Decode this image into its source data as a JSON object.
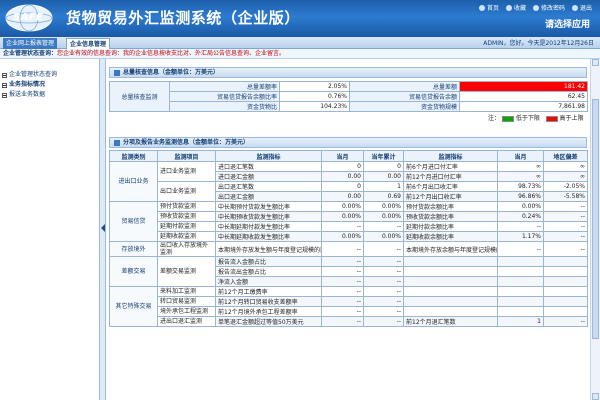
{
  "header": {
    "logo_text": "SAFE",
    "title": "货物贸易外汇监测系统（企业版）",
    "top_links": [
      "首页",
      "收藏",
      "修改密码",
      "退出"
    ],
    "welcome": "请选择应用"
  },
  "nav": {
    "tabs": [
      {
        "label": "企业网上报表管理",
        "active": false
      },
      {
        "label": "企业信息管理",
        "active": true
      }
    ],
    "user_info": "ADMIN，您好。今天是2012年12月26日"
  },
  "notice": {
    "label": "企业管理状态查询：",
    "text": "您企业有效的信息查询：我的企业信息按收支比对、外汇局公告信息查询、企业留言。"
  },
  "sidebar": {
    "items": [
      {
        "label": "企业管理状态查询",
        "bold": false
      },
      {
        "label": "业务指标情况",
        "bold": true
      },
      {
        "label": "报送业务数据",
        "bold": false
      }
    ]
  },
  "summary": {
    "title": "总量核查信息（金额单位：万美元）",
    "group_label": "总量核查监测",
    "rows": [
      {
        "l1": "总量差额率",
        "v1": "2.05%",
        "l2": "总量差额",
        "v2": "181.42",
        "v2_red": true
      },
      {
        "l1": "贸易信贷报告余额比率",
        "v1": "0.76%",
        "l2": "贸易信贷报告余额",
        "v2": "62.45",
        "v2_red": false
      },
      {
        "l1": "资金货物比",
        "v1": "104.23%",
        "l2": "资金货物规模",
        "v2": "7,861.98",
        "v2_red": false
      }
    ],
    "legend_label": "注：",
    "legend": [
      {
        "label": "低于下限",
        "color": "#00aa00"
      },
      {
        "label": "高于上限",
        "color": "#ff0000"
      }
    ]
  },
  "detail": {
    "title": "分项及报告业务监测信息（金额单位：万美元）",
    "columns": [
      "监测类别",
      "监测项目",
      "监测指标",
      "当月",
      "当年累计",
      "监测指标",
      "当月",
      "地区偏差"
    ],
    "rows": [
      {
        "cat": "进出口业务",
        "item": "进口业务监测",
        "ind1": "进口退汇笔数",
        "m1": "0",
        "y1": "0",
        "ind2": "前6个月进口付汇率",
        "m2": "∞",
        "d2": "∞"
      },
      {
        "cat": "",
        "item": "",
        "ind1": "进口退汇金额",
        "m1": "0.00",
        "y1": "0.00",
        "ind2": "前12个月进口付汇率",
        "m2": "∞",
        "d2": "∞"
      },
      {
        "cat": "",
        "item": "出口业务监测",
        "ind1": "出口退汇笔数",
        "m1": "0",
        "y1": "1",
        "ind2": "前6个月出口收汇率",
        "m2": "98.73%",
        "d2": "-2.05%"
      },
      {
        "cat": "",
        "item": "",
        "ind1": "出口退汇金额",
        "m1": "0.00",
        "y1": "0.69",
        "ind2": "前12个月出口收汇率",
        "m2": "96.86%",
        "d2": "-5.58%"
      },
      {
        "cat": "贸易信贷",
        "item": "预付货款监测",
        "ind1": "中长期预付货款发生额比率",
        "m1": "0.00%",
        "y1": "0.00%",
        "ind2": "预付货款余额比率",
        "m2": "0.00%",
        "d2": "--"
      },
      {
        "cat": "",
        "item": "预收货款监测",
        "ind1": "中长期预收货款发生额比率",
        "m1": "0.00%",
        "y1": "0.00%",
        "ind2": "预收货款余额比率",
        "m2": "0.24%",
        "d2": "--"
      },
      {
        "cat": "",
        "item": "延期付款监测",
        "ind1": "中长期延期付款发生额比率",
        "m1": "--",
        "y1": "--",
        "ind2": "延期付款余额比率",
        "m2": "--",
        "d2": "--"
      },
      {
        "cat": "",
        "item": "延期收款监测",
        "ind1": "中长期延期收款发生额比率",
        "m1": "0.00%",
        "y1": "0.00%",
        "ind2": "延期收款余额比率",
        "m2": "1.17%",
        "d2": "--"
      },
      {
        "cat": "存放境外",
        "item": "出口收入存放境外监测",
        "ind1": "本期境外存放发生额与年度登记规模的比率",
        "m1": "--",
        "y1": "--",
        "ind2": "本期境外存放余额与年度登记规模的比率",
        "m2": "--",
        "d2": "--"
      },
      {
        "cat": "差额交易",
        "item": "差额交易监测",
        "ind1": "报告流入金额占比",
        "m1": "--",
        "y1": "--",
        "ind2": "",
        "m2": "",
        "d2": ""
      },
      {
        "cat": "",
        "item": "",
        "ind1": "报告流出金额占比",
        "m1": "--",
        "y1": "--",
        "ind2": "",
        "m2": "",
        "d2": ""
      },
      {
        "cat": "",
        "item": "",
        "ind1": "净流入金额",
        "m1": "--",
        "y1": "--",
        "ind2": "",
        "m2": "",
        "d2": ""
      },
      {
        "cat": "其它特殊交易",
        "item": "来料加工监测",
        "ind1": "前12个月工缴费率",
        "m1": "--",
        "y1": "--",
        "ind2": "",
        "m2": "",
        "d2": ""
      },
      {
        "cat": "",
        "item": "转口贸易监测",
        "ind1": "前12个月转口贸易收支差额率",
        "m1": "--",
        "y1": "--",
        "ind2": "",
        "m2": "",
        "d2": ""
      },
      {
        "cat": "",
        "item": "境外承包工程监测",
        "ind1": "前12个月境外承包工程差额率",
        "m1": "--",
        "y1": "--",
        "ind2": "",
        "m2": "",
        "d2": ""
      },
      {
        "cat": "",
        "item": "进出口退汇监测",
        "ind1": "单笔退汇金额超过等值50万美元",
        "m1": "--",
        "y1": "--",
        "ind2": "前12个月退汇笔数",
        "m2": "1",
        "d2": "--"
      }
    ]
  }
}
